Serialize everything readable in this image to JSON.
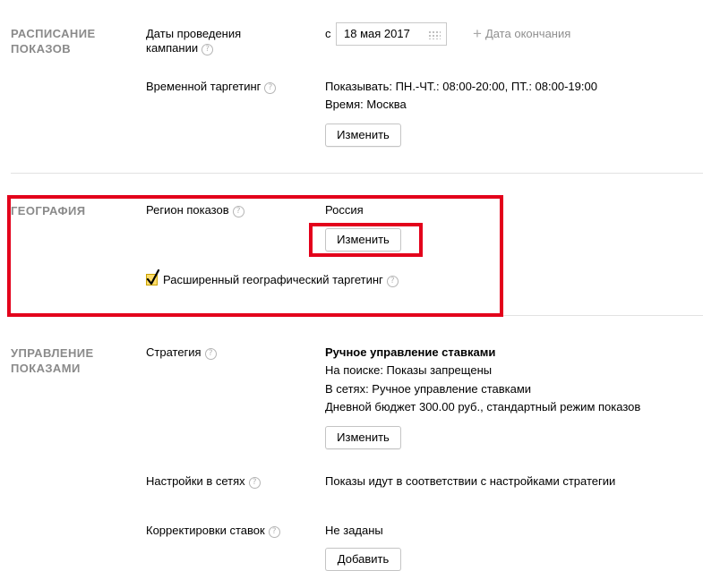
{
  "schedule": {
    "title_line1": "РАСПИСАНИЕ",
    "title_line2": "ПОКАЗОВ",
    "dates_label_line1": "Даты проведения",
    "dates_label_line2": "кампании",
    "from_prefix": "с",
    "start_date": "18 мая 2017",
    "add_end_date": "Дата окончания",
    "time_targeting_label": "Временной таргетинг",
    "time_targeting_value_line1": "Показывать: ПН.-ЧТ.: 08:00-20:00, ПТ.: 08:00-19:00",
    "time_targeting_value_line2": "Время: Москва",
    "change_button": "Изменить"
  },
  "geography": {
    "title": "ГЕОГРАФИЯ",
    "region_label": "Регион показов",
    "region_value": "Россия",
    "change_button": "Изменить",
    "extended_targeting_label": "Расширенный географический таргетинг",
    "extended_targeting_checked": true
  },
  "management": {
    "title_line1": "УПРАВЛЕНИЕ",
    "title_line2": "ПОКАЗАМИ",
    "strategy_label": "Стратегия",
    "strategy_name": "Ручное управление ставками",
    "strategy_search": "На поиске: Показы запрещены",
    "strategy_networks": "В сетях: Ручное управление ставками",
    "strategy_budget": "Дневной бюджет 300.00 руб., стандартный режим показов",
    "change_button": "Изменить",
    "network_settings_label": "Настройки в сетях",
    "network_settings_value": "Показы идут в соответствии с настройками стратегии",
    "bid_adjustments_label": "Корректировки ставок",
    "bid_adjustments_value": "Не заданы",
    "add_button": "Добавить"
  },
  "icons": {
    "help": "question-circle-icon",
    "plus": "plus-icon",
    "calendar": "calendar-icon",
    "check": "checkmark-icon"
  },
  "colors": {
    "section_title": "#8a8a8a",
    "highlight": "#e3001b",
    "checkbox_fill": "#fddc6b"
  }
}
